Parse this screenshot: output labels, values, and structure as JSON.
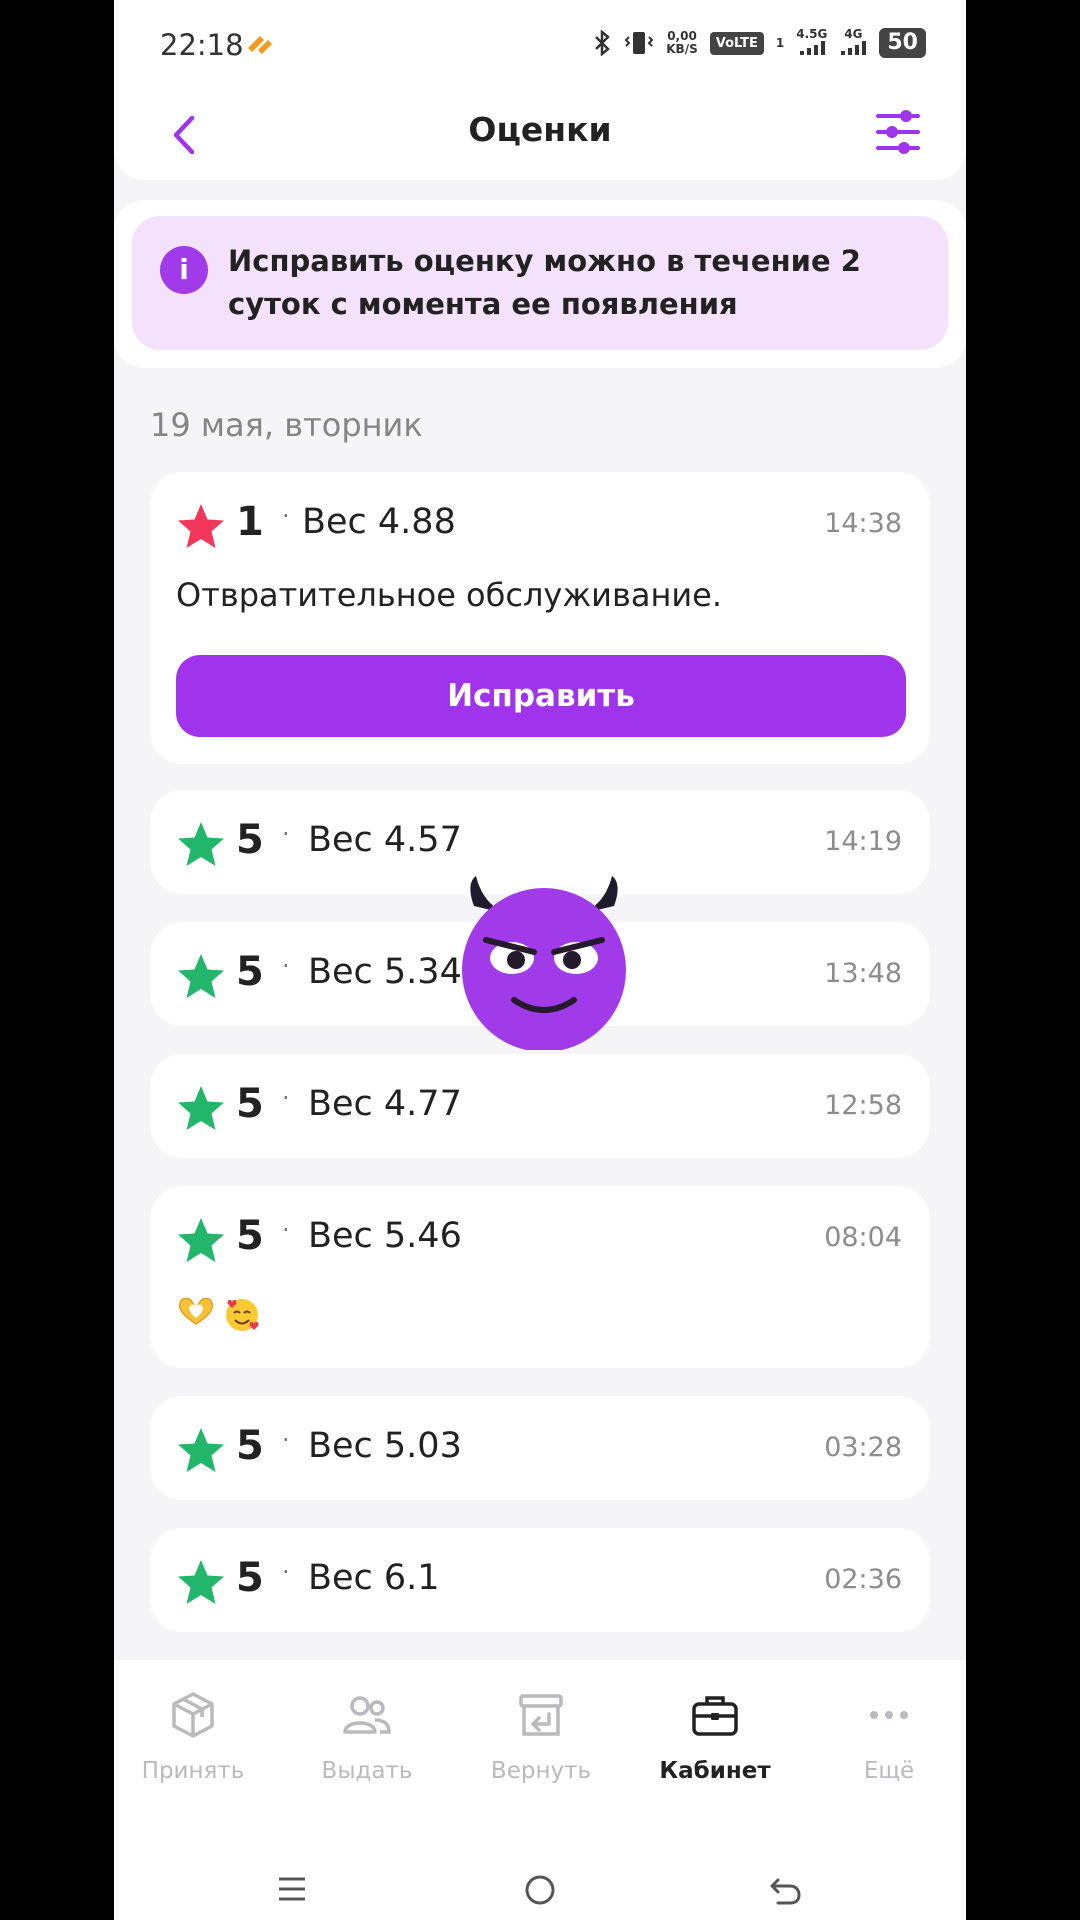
{
  "status_bar": {
    "time": "22:18",
    "speed_value": "0,00",
    "speed_unit": "KB/S",
    "volte": "VoLTE",
    "sim_index": "1",
    "net1": "4.5G",
    "net2": "4G",
    "battery": "50"
  },
  "header": {
    "title": "Оценки"
  },
  "info_banner": {
    "icon": "i",
    "text": "Исправить оценку можно в течение 2 суток с момента ее появления"
  },
  "date_group": "19 мая, вторник",
  "ratings": [
    {
      "score": "1",
      "weight": "Вес 4.88",
      "time": "14:38",
      "comment": "Отвратительное обслуживание.",
      "button": "Исправить",
      "star_color": "#f2375a"
    },
    {
      "score": "5",
      "weight": "Вес 4.57",
      "time": "14:19",
      "star_color": "#21b66a"
    },
    {
      "score": "5",
      "weight": "Вес 5.34",
      "time": "13:48",
      "star_color": "#21b66a"
    },
    {
      "score": "5",
      "weight": "Вес 4.77",
      "time": "12:58",
      "star_color": "#21b66a"
    },
    {
      "score": "5",
      "weight": "Вес 5.46",
      "time": "08:04",
      "emoji": [
        "🫶",
        "🥰"
      ],
      "star_color": "#21b66a"
    },
    {
      "score": "5",
      "weight": "Вес 5.03",
      "time": "03:28",
      "star_color": "#21b66a"
    },
    {
      "score": "5",
      "weight": "Вес 6.1",
      "time": "02:36",
      "star_color": "#21b66a"
    }
  ],
  "separator": "·",
  "bottom_nav": [
    {
      "label": "Принять",
      "icon": "box-icon"
    },
    {
      "label": "Выдать",
      "icon": "users-icon"
    },
    {
      "label": "Вернуть",
      "icon": "return-box-icon"
    },
    {
      "label": "Кабинет",
      "icon": "briefcase-icon",
      "active": true
    },
    {
      "label": "Ещё",
      "icon": "more-dots-icon"
    }
  ],
  "colors": {
    "accent": "#a033ec",
    "banner": "#f4e1fc",
    "star_good": "#21b66a",
    "star_bad": "#f2375a"
  }
}
